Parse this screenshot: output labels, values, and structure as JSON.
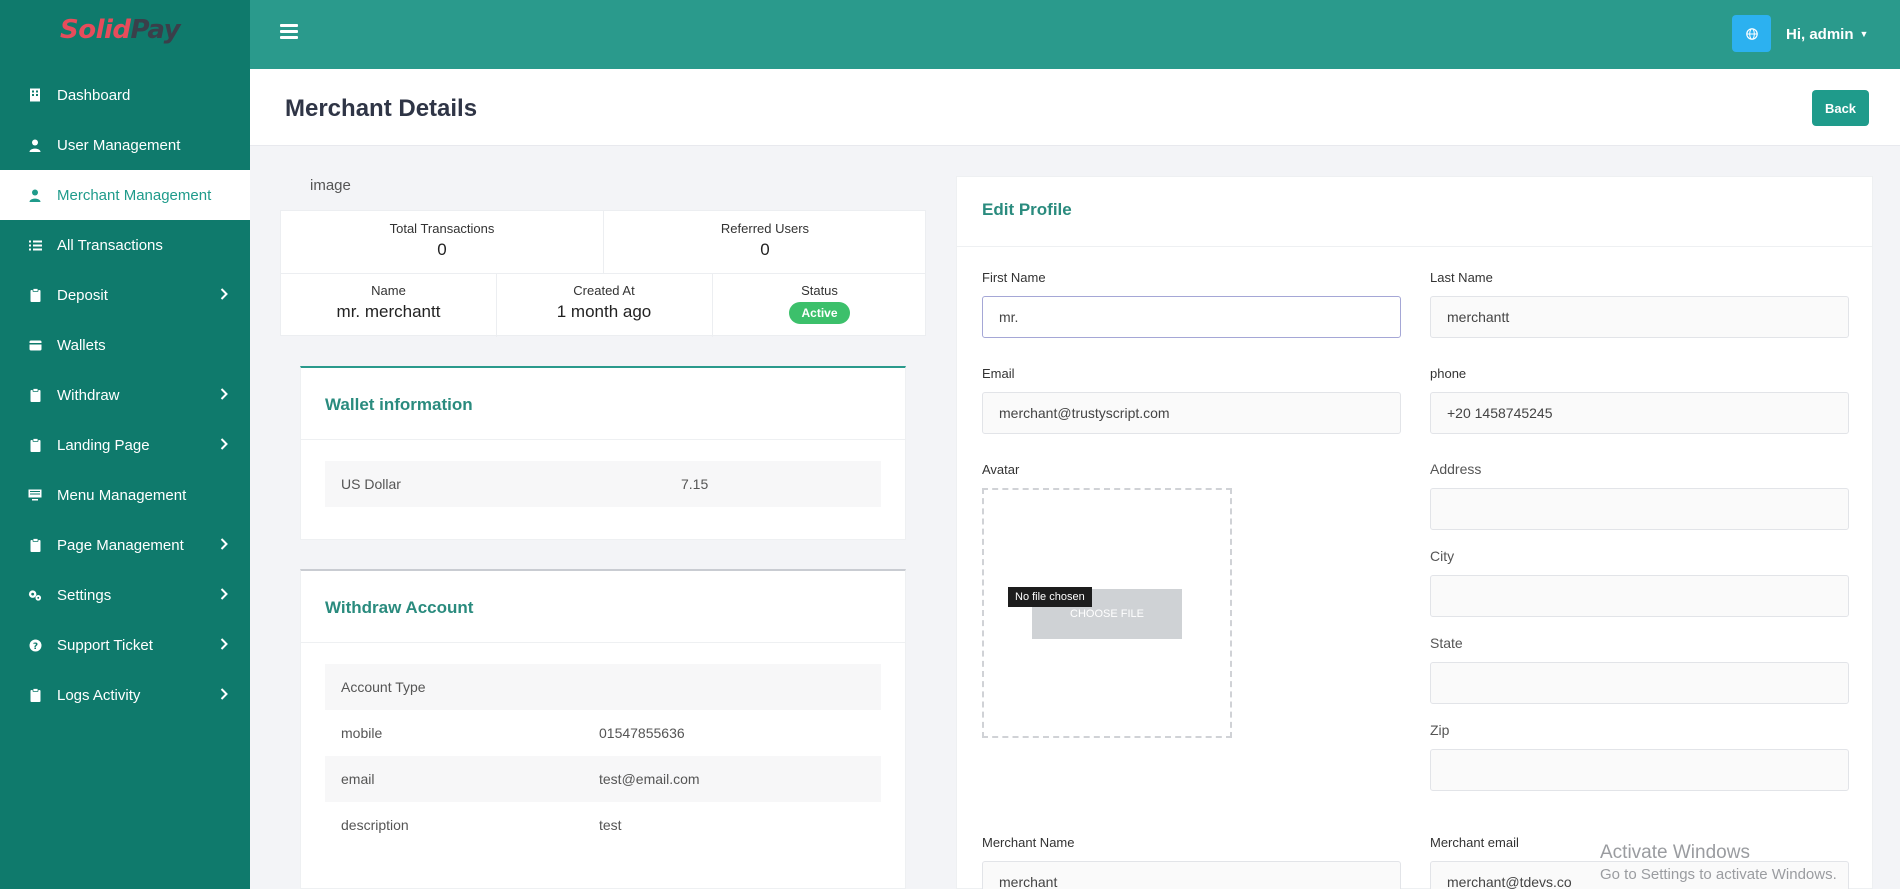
{
  "brand": {
    "part1": "Solid",
    "part2": "Pay"
  },
  "sidebar": {
    "items": [
      {
        "label": "Dashboard",
        "icon": "building-icon",
        "chevron": false,
        "active": false
      },
      {
        "label": "User Management",
        "icon": "user-icon",
        "chevron": false,
        "active": false
      },
      {
        "label": "Merchant Management",
        "icon": "user-icon",
        "chevron": false,
        "active": true
      },
      {
        "label": "All Transactions",
        "icon": "list-icon",
        "chevron": false,
        "active": false
      },
      {
        "label": "Deposit",
        "icon": "clipboard-icon",
        "chevron": true,
        "active": false
      },
      {
        "label": "Wallets",
        "icon": "wallet-icon",
        "chevron": false,
        "active": false
      },
      {
        "label": "Withdraw",
        "icon": "clipboard-icon",
        "chevron": true,
        "active": false
      },
      {
        "label": "Landing Page",
        "icon": "clipboard-icon",
        "chevron": true,
        "active": false
      },
      {
        "label": "Menu Management",
        "icon": "monitor-icon",
        "chevron": false,
        "active": false
      },
      {
        "label": "Page Management",
        "icon": "clipboard-icon",
        "chevron": true,
        "active": false
      },
      {
        "label": "Settings",
        "icon": "gears-icon",
        "chevron": true,
        "active": false
      },
      {
        "label": "Support Ticket",
        "icon": "question-icon",
        "chevron": true,
        "active": false
      },
      {
        "label": "Logs Activity",
        "icon": "clipboard-icon",
        "chevron": true,
        "active": false
      }
    ]
  },
  "topbar": {
    "user_label": "Hi, admin"
  },
  "header": {
    "title": "Merchant Details",
    "back_label": "Back"
  },
  "profile": {
    "image_alt": "image",
    "total_transactions_label": "Total Transactions",
    "total_transactions": "0",
    "referred_users_label": "Referred Users",
    "referred_users": "0",
    "name_label": "Name",
    "name": "mr. merchantt",
    "created_label": "Created At",
    "created": "1 month ago",
    "status_label": "Status",
    "status": "Active"
  },
  "wallet": {
    "title": "Wallet information",
    "rows": [
      {
        "currency": "US Dollar",
        "amount": "7.15"
      }
    ]
  },
  "withdraw": {
    "title": "Withdraw Account",
    "rows": [
      {
        "key": "Account Type",
        "value": ""
      },
      {
        "key": "mobile",
        "value": "01547855636"
      },
      {
        "key": "email",
        "value": "test@email.com"
      },
      {
        "key": "description",
        "value": "test"
      }
    ]
  },
  "edit": {
    "title": "Edit Profile",
    "first_name_label": "First Name",
    "first_name": "mr.",
    "last_name_label": "Last Name",
    "last_name": "merchantt",
    "email_label": "Email",
    "email": "merchant@trustyscript.com",
    "phone_label": "phone",
    "phone": "+20 1458745245",
    "avatar_label": "Avatar",
    "choose_file": "CHOOSE FILE",
    "no_file": "No file chosen",
    "address_label": "Address",
    "address": "",
    "city_label": "City",
    "city": "",
    "state_label": "State",
    "state": "",
    "zip_label": "Zip",
    "zip": "",
    "merchant_name_label": "Merchant Name",
    "merchant_name": "merchant",
    "merchant_email_label": "Merchant email",
    "merchant_email": "merchant@tdevs.co"
  },
  "watermark": {
    "line1": "Activate Windows",
    "line2": "Go to Settings to activate Windows."
  },
  "colors": {
    "sidebar": "#0f7a6c",
    "topbar": "#2a9a8c",
    "accent": "#1f9b8b",
    "status_active": "#3cc06b",
    "language_button": "#2cb1f0"
  }
}
